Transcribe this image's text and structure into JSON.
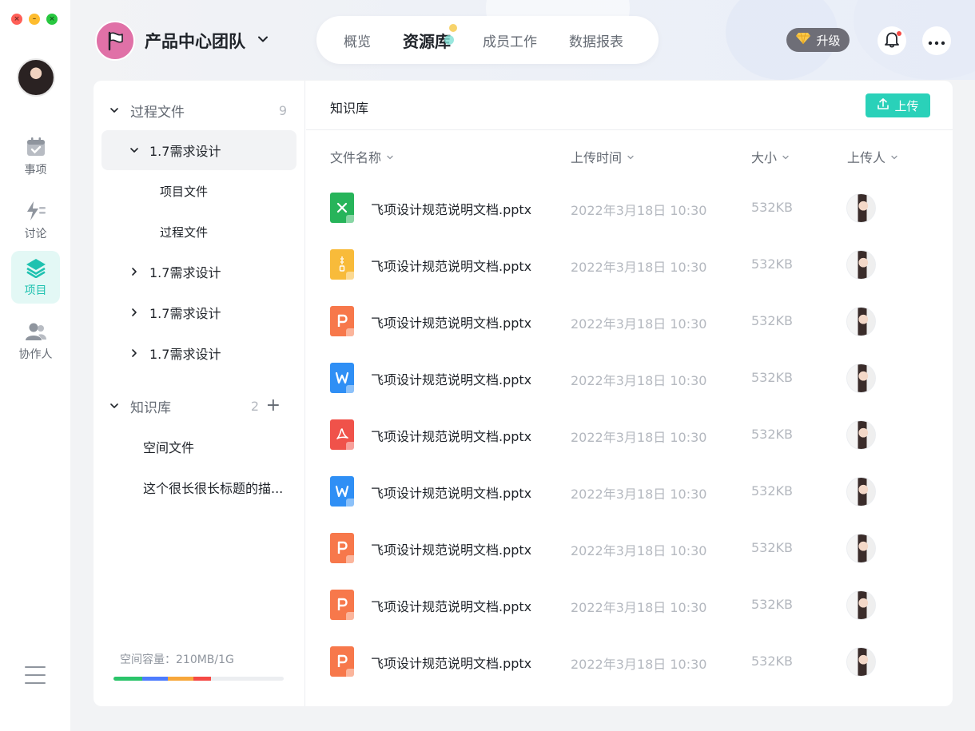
{
  "window": {
    "close_glyph": "×",
    "minimize_glyph": "–",
    "zoom_glyph": "×"
  },
  "rail": {
    "items": [
      {
        "label": "事项",
        "icon": "calendar-check-icon"
      },
      {
        "label": "讨论",
        "icon": "lightning-chat-icon"
      },
      {
        "label": "项目",
        "icon": "layers-icon",
        "active": true
      },
      {
        "label": "协作人",
        "icon": "people-icon"
      }
    ]
  },
  "header": {
    "team_name": "产品中心团队",
    "tabs": [
      {
        "label": "概览"
      },
      {
        "label": "资源库",
        "active": true
      },
      {
        "label": "成员工作"
      },
      {
        "label": "数据报表"
      }
    ],
    "upgrade_label": "升级"
  },
  "tree": {
    "section1": {
      "label": "过程文件",
      "count": "9"
    },
    "items": [
      {
        "label": "1.7需求设计",
        "expanded": true
      },
      {
        "label": "项目文件"
      },
      {
        "label": "过程文件"
      },
      {
        "label": "1.7需求设计"
      },
      {
        "label": "1.7需求设计"
      },
      {
        "label": "1.7需求设计"
      }
    ],
    "section2": {
      "label": "知识库",
      "count": "2",
      "add": "+"
    },
    "kb_items": [
      {
        "label": "空间文件"
      },
      {
        "label": "这个很长很长标题的描..."
      }
    ],
    "storage": {
      "label": "空间容量：210MB/1G",
      "used_fraction": 0.575,
      "segments": [
        {
          "color": "#2bc46a",
          "fraction": 0.17
        },
        {
          "color": "#4d7cfe",
          "fraction": 0.15
        },
        {
          "color": "#f7a73b",
          "fraction": 0.15
        },
        {
          "color": "#f54a45",
          "fraction": 0.105
        }
      ]
    }
  },
  "content": {
    "title": "知识库",
    "upload_label": "上传",
    "columns": {
      "name": "文件名称",
      "time": "上传时间",
      "size": "大小",
      "uploader": "上传人"
    },
    "files": [
      {
        "name": "飞项设计规范说明文档.pptx",
        "time": "2022年3月18日 10:30",
        "size": "532KB",
        "type": "excel",
        "color": "#27b45a"
      },
      {
        "name": "飞项设计规范说明文档.pptx",
        "time": "2022年3月18日 10:30",
        "size": "532KB",
        "type": "zip",
        "color": "#f8bb3a"
      },
      {
        "name": "飞项设计规范说明文档.pptx",
        "time": "2022年3月18日 10:30",
        "size": "532KB",
        "type": "ppt",
        "color": "#f7784b"
      },
      {
        "name": "飞项设计规范说明文档.pptx",
        "time": "2022年3月18日 10:30",
        "size": "532KB",
        "type": "word",
        "color": "#2f8ff5"
      },
      {
        "name": "飞项设计规范说明文档.pptx",
        "time": "2022年3月18日 10:30",
        "size": "532KB",
        "type": "pdf",
        "color": "#f0524a"
      },
      {
        "name": "飞项设计规范说明文档.pptx",
        "time": "2022年3月18日 10:30",
        "size": "532KB",
        "type": "word",
        "color": "#2f8ff5"
      },
      {
        "name": "飞项设计规范说明文档.pptx",
        "time": "2022年3月18日 10:30",
        "size": "532KB",
        "type": "ppt",
        "color": "#f7784b"
      },
      {
        "name": "飞项设计规范说明文档.pptx",
        "time": "2022年3月18日 10:30",
        "size": "532KB",
        "type": "ppt",
        "color": "#f7784b"
      },
      {
        "name": "飞项设计规范说明文档.pptx",
        "time": "2022年3月18日 10:30",
        "size": "532KB",
        "type": "ppt",
        "color": "#f7784b"
      }
    ]
  }
}
